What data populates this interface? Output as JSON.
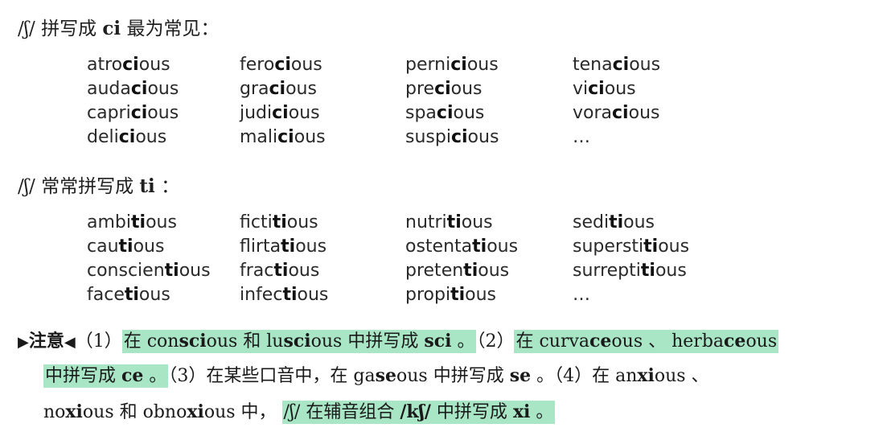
{
  "section1": {
    "ipa": "/ʃ/",
    "label": "拼写成",
    "pattern": "ci",
    "suffix": "最为常见：",
    "words": [
      [
        [
          "atro",
          "ci",
          "ous"
        ],
        [
          "fero",
          "ci",
          "ous"
        ],
        [
          "perni",
          "ci",
          "ous"
        ],
        [
          "tena",
          "ci",
          "ous"
        ]
      ],
      [
        [
          "auda",
          "ci",
          "ous"
        ],
        [
          "gra",
          "ci",
          "ous"
        ],
        [
          "pre",
          "ci",
          "ous"
        ],
        [
          "vi",
          "ci",
          "ous"
        ]
      ],
      [
        [
          "capri",
          "ci",
          "ous"
        ],
        [
          "judi",
          "ci",
          "ous"
        ],
        [
          "spa",
          "ci",
          "ous"
        ],
        [
          "vora",
          "ci",
          "ous"
        ]
      ],
      [
        [
          "deli",
          "ci",
          "ous"
        ],
        [
          "mali",
          "ci",
          "ous"
        ],
        [
          "suspi",
          "ci",
          "ous"
        ],
        [
          "…",
          "",
          ""
        ]
      ]
    ]
  },
  "section2": {
    "ipa": "/ʃ/",
    "label": "常常拼写成",
    "pattern": "ti",
    "suffix": "：",
    "words": [
      [
        [
          "ambi",
          "ti",
          "ous"
        ],
        [
          "ficti",
          "ti",
          "ous"
        ],
        [
          "nutri",
          "ti",
          "ous"
        ],
        [
          "sedi",
          "ti",
          "ous"
        ]
      ],
      [
        [
          "cau",
          "ti",
          "ous"
        ],
        [
          "flirta",
          "ti",
          "ous"
        ],
        [
          "ostenta",
          "ti",
          "ous"
        ],
        [
          "supersti",
          "ti",
          "ous"
        ]
      ],
      [
        [
          "conscien",
          "ti",
          "ous"
        ],
        [
          "frac",
          "ti",
          "ous"
        ],
        [
          "preten",
          "ti",
          "ous"
        ],
        [
          "surrepti",
          "ti",
          "ous"
        ]
      ],
      [
        [
          "face",
          "ti",
          "ous"
        ],
        [
          "infec",
          "ti",
          "ous"
        ],
        [
          "propi",
          "ti",
          "ous"
        ],
        [
          "…",
          "",
          ""
        ]
      ]
    ]
  },
  "note": {
    "marker_left": "▶",
    "title": "注意",
    "marker_right": "◀",
    "p1_num": "（1）",
    "p1_a": "在 con",
    "p1_b": "sci",
    "p1_c": "ous 和 lu",
    "p1_d": "sci",
    "p1_e": "ous 中拼写成 ",
    "p1_f": "sci",
    "p1_g": " 。",
    "p2_num": "（2）",
    "p2_a": "在 curva",
    "p2_b": "ce",
    "p2_c": "ous 、 herba",
    "p2_d": "ce",
    "p2_e": "ous",
    "p2_f": "中拼写成 ",
    "p2_g": "ce",
    "p2_h": " 。",
    "p3_num": "（3）",
    "p3_a": "在某些口音中，在 ga",
    "p3_b": "se",
    "p3_c": "ous 中拼写成 ",
    "p3_d": "se",
    "p3_e": " 。",
    "p4_num": "（4）",
    "p4_a": "在 an",
    "p4_b": "xi",
    "p4_c": "ous 、",
    "p4_d": "no",
    "p4_e": "xi",
    "p4_f": "ous 和 obno",
    "p4_g": "xi",
    "p4_h": "ous 中，",
    "p4_i": "/ʃ/ 在辅音组合 ",
    "p4_j": "/kʃ/",
    "p4_k": " 中拼写成 ",
    "p4_l": "xi",
    "p4_m": " 。"
  },
  "colors": {
    "highlight": "#a9e6c6",
    "text": "#1f1f1f"
  }
}
